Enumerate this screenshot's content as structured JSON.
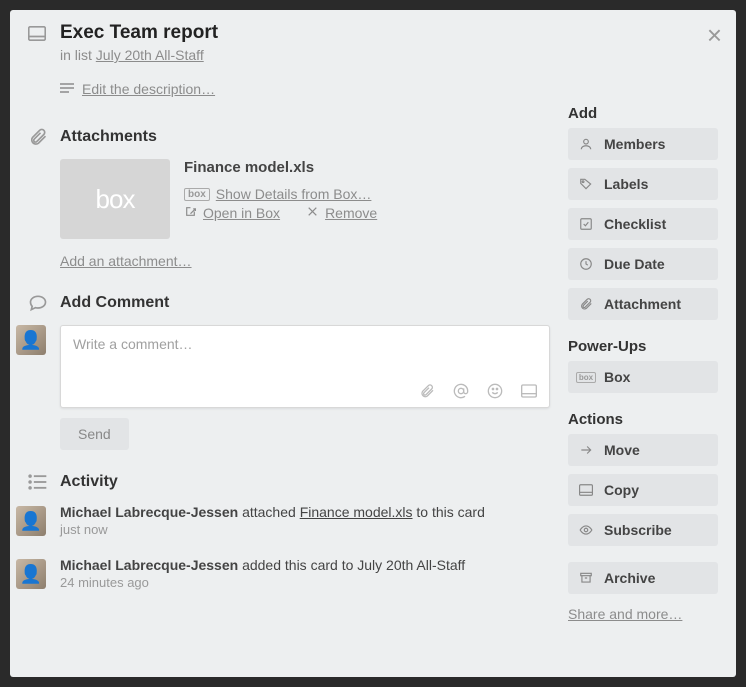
{
  "card": {
    "title": "Exec Team report",
    "in_list_prefix": "in list",
    "list_name": "July 20th All-Staff",
    "edit_description": "Edit the description…"
  },
  "attachments": {
    "title": "Attachments",
    "items": [
      {
        "thumb_label": "box",
        "name": "Finance model.xls",
        "provider_badge": "box",
        "show_details": "Show Details from Box…",
        "open_in": "Open in Box",
        "remove": "Remove"
      }
    ],
    "add": "Add an attachment…"
  },
  "comment": {
    "title": "Add Comment",
    "placeholder": "Write a comment…",
    "send": "Send"
  },
  "activity": {
    "title": "Activity",
    "items": [
      {
        "user": "Michael Labrecque-Jessen",
        "action_prefix": " attached ",
        "link": "Finance model.xls",
        "action_suffix": " to this card",
        "time": "just now"
      },
      {
        "user": "Michael Labrecque-Jessen",
        "action_prefix": " added this card to July 20th All-Staff",
        "link": "",
        "action_suffix": "",
        "time": "24 minutes ago"
      }
    ]
  },
  "sidebar": {
    "add": {
      "title": "Add",
      "members": "Members",
      "labels": "Labels",
      "checklist": "Checklist",
      "due_date": "Due Date",
      "attachment": "Attachment"
    },
    "powerups": {
      "title": "Power-Ups",
      "box": "Box",
      "box_badge": "box"
    },
    "actions": {
      "title": "Actions",
      "move": "Move",
      "copy": "Copy",
      "subscribe": "Subscribe",
      "archive": "Archive"
    },
    "share": "Share and more…"
  }
}
